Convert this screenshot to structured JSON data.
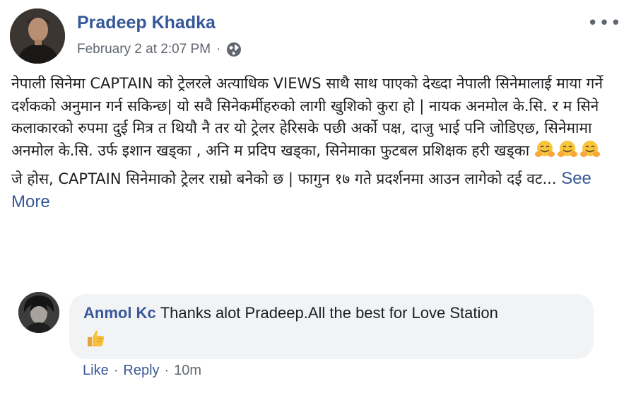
{
  "post": {
    "author": "Pradeep Khadka",
    "timestamp": "February 2 at 2:07 PM",
    "separator": "·",
    "privacy_icon": "globe-icon",
    "menu_icon": "more-options-icon",
    "paragraph1": "नेपाली सिनेमा CAPTAIN को ट्रेलरले अत्याधिक VIEWS साथै साथ पाएको देख्दा नेपाली सिनेमालाई माया गर्ने दर्शकको अनुमान गर्न सकिन्छ| यो सवै सिनेकर्मीहरुको लागी खुशिको कुरा हो | नायक अनमोल के.सि. र म सिने कलाकारको रुपमा दुई मित्र त थियौ नै तर यो ट्रेलर हेरिसके पछी अर्को पक्ष, दाजु भाई पनि जोडिएछ, सिनेमामा अनमोल के.सि. उर्फ इशान खड्का , अनि म प्रदिप खड्का, सिनेमाका फुटबल प्रशिक्षक हरी खड्का",
    "paragraph1_emoji": "hugging-face-emoji",
    "paragraph2": "जे होस, CAPTAIN सिनेमाको ट्रेलर राम्रो बनेको छ | फागुन १७ गते प्रदर्शनमा आउन लागेको दई वट...",
    "see_more": "See More"
  },
  "comment": {
    "author": "Anmol Kc",
    "text": "Thanks alot Pradeep.All the best for Love Station",
    "emoji": "thumbs-up-emoji",
    "like": "Like",
    "reply": "Reply",
    "time": "10m",
    "separator": "·"
  },
  "colors": {
    "link": "#385898",
    "meta": "#616770",
    "bubble": "#f2f3f5"
  }
}
